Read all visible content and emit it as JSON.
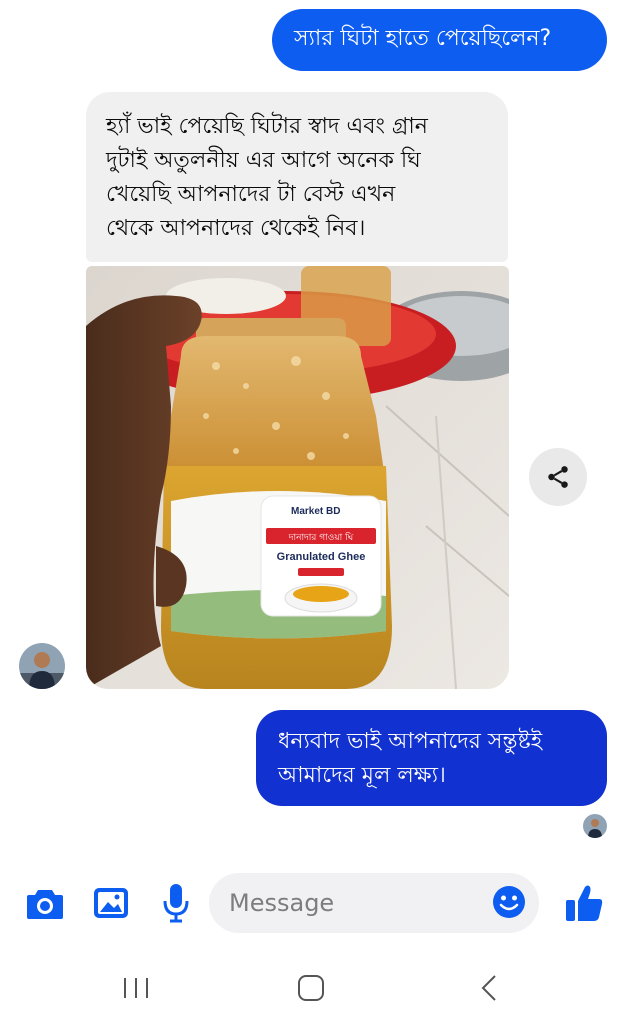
{
  "conversation": {
    "messages": [
      {
        "direction": "outgoing",
        "lines": [
          "স্যার ঘিটা হাতে পেয়েছিলেন?"
        ]
      },
      {
        "direction": "incoming",
        "lines": [
          "হ্যাঁ ভাই পেয়েছি ঘিটার স্বাদ এবং গ্রান",
          "দুটাই অতুলনীয় এর আগে অনেক ঘি",
          "খেয়েছি আপনাদের টা বেস্ট  এখন",
          "থেকে আপনাদের থেকেই নিব।"
        ]
      },
      {
        "direction": "outgoing",
        "lines": [
          "ধন্যবাদ ভাই আপনাদের সন্তুষ্টই",
          "আমাদের মূল লক্ষ্য।"
        ]
      }
    ],
    "photo": {
      "label": {
        "brand": "Market BD",
        "bangla_name": "দানাদার গাওয়া ঘি",
        "english_name": "Granulated Ghee"
      }
    },
    "share_icon": "share-icon"
  },
  "composer": {
    "placeholder": "Message",
    "icons": [
      "camera-icon",
      "gallery-icon",
      "microphone-icon",
      "emoji-icon",
      "thumbs-up-icon"
    ],
    "accent_color": "#0d5df0"
  },
  "navigation": {
    "icons": [
      "recent-apps-icon",
      "home-icon",
      "back-icon"
    ]
  },
  "colors": {
    "outgoing_bubble": "#0d5df0",
    "outgoing_bubble_dark": "#1131d0",
    "incoming_bubble": "#f0f0f0"
  }
}
